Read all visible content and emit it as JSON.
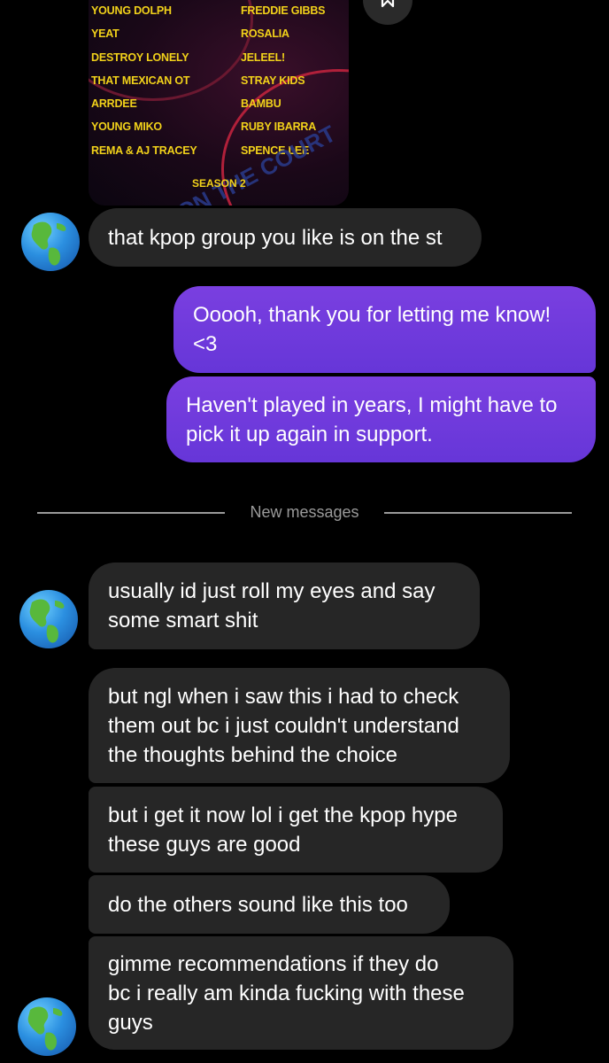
{
  "shared_post": {
    "left_names": [
      "YOUNG DOLPH",
      "YEAT",
      "DESTROY LONELY",
      "THAT MEXICAN OT",
      "ARRDEE",
      "YOUNG MIKO",
      "REMA & AJ TRACEY"
    ],
    "right_names": [
      "FREDDIE GIBBS",
      "ROSALIA",
      "JELEEL!",
      "STRAY KIDS",
      "BAMBU",
      "RUBY IBARRA",
      "SPENCE LEE"
    ],
    "season": "SEASON 2",
    "overlay_text": "YOU ON THE COURT"
  },
  "divider": {
    "label": "New messages"
  },
  "messages": [
    {
      "id": "m1",
      "text": "that kpop group you like is on the st"
    },
    {
      "id": "m2",
      "text": "Ooooh, thank you for letting me know!\n<3"
    },
    {
      "id": "m3",
      "text": "Haven't played in years, I might have to\npick it up again in support."
    },
    {
      "id": "m4",
      "text": "usually id just roll my eyes and say\nsome smart shit"
    },
    {
      "id": "m5",
      "text": "but ngl when i saw this i had to check\nthem out bc i just couldn't understand\nthe thoughts behind the choice"
    },
    {
      "id": "m6",
      "text": "but i get it now lol i get the kpop hype\nthese guys are good"
    },
    {
      "id": "m7",
      "text": "do the others sound like this too"
    },
    {
      "id": "m8",
      "text": "gimme recommendations if they do\nbc i really am kinda fucking with these\nguys"
    }
  ],
  "colors": {
    "incoming_bubble": "#262626",
    "outgoing_bubble": "#6a38da",
    "poster_text": "#f2d21a"
  },
  "icons": {
    "avatar": "globe-americas-icon",
    "share": "bookmark-icon"
  }
}
